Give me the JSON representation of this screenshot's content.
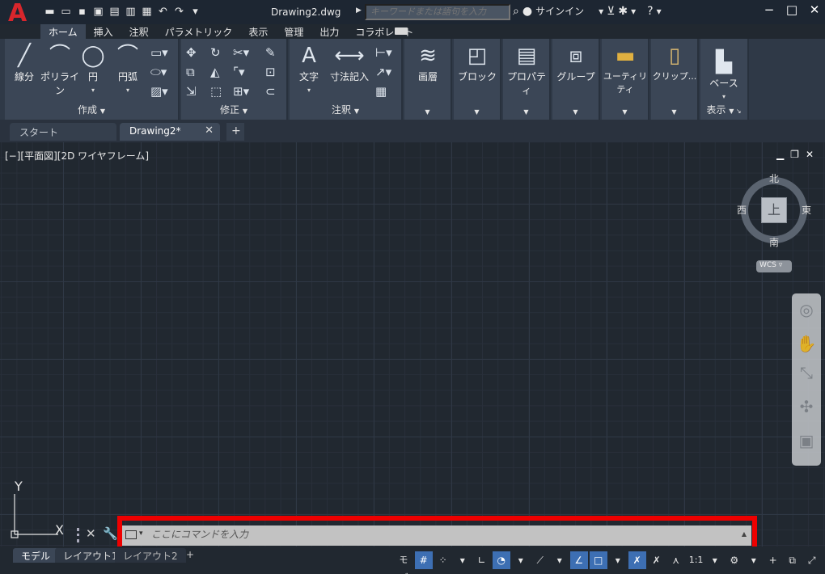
{
  "title_bar": {
    "doc_title": "Drawing2.dwg",
    "search_placeholder": "キーワードまたは語句を入力",
    "signin": "サインイン"
  },
  "ribbon_tabs": [
    "ホーム",
    "挿入",
    "注釈",
    "パラメトリック",
    "表示",
    "管理",
    "出力",
    "コラボレート"
  ],
  "ribbon": {
    "draw_panel": {
      "title": "作成",
      "line": "線分",
      "polyline": "ポリライン",
      "circle": "円",
      "arc": "円弧"
    },
    "modify_panel": {
      "title": "修正"
    },
    "annotation_panel": {
      "title": "注釈",
      "text": "文字",
      "dimension": "寸法記入"
    },
    "layers_panel": {
      "label": "画層"
    },
    "block_panel": {
      "label": "ブロック"
    },
    "properties_panel": {
      "label": "プロパティ"
    },
    "groups_panel": {
      "label": "グループ"
    },
    "utilities_panel": {
      "label": "ユーティリティ"
    },
    "clipboard_panel": {
      "label": "クリップ..."
    },
    "view_panel": {
      "title": "表示",
      "base": "ベース"
    }
  },
  "file_tabs": {
    "start": "スタート",
    "drawing": "Drawing2*"
  },
  "viewport": {
    "label": "[−][平面図][2D ワイヤフレーム]",
    "compass": {
      "north": "北",
      "south": "南",
      "east": "東",
      "west": "西",
      "top": "上"
    },
    "wcs": "WCS"
  },
  "ucs": {
    "y_label": "Y",
    "x_label": "X"
  },
  "command_line": {
    "placeholder": "ここにコマンドを入力"
  },
  "layout_tabs": {
    "model": "モデル",
    "layout1": "レイアウト1",
    "layout2": "レイアウト2"
  },
  "status_bar": {
    "model": "モデル",
    "scale": "1:1"
  },
  "colors": {
    "accent_red": "#ee0000",
    "logo_red": "#d8262c",
    "toggle_on": "#3d6fb3"
  }
}
